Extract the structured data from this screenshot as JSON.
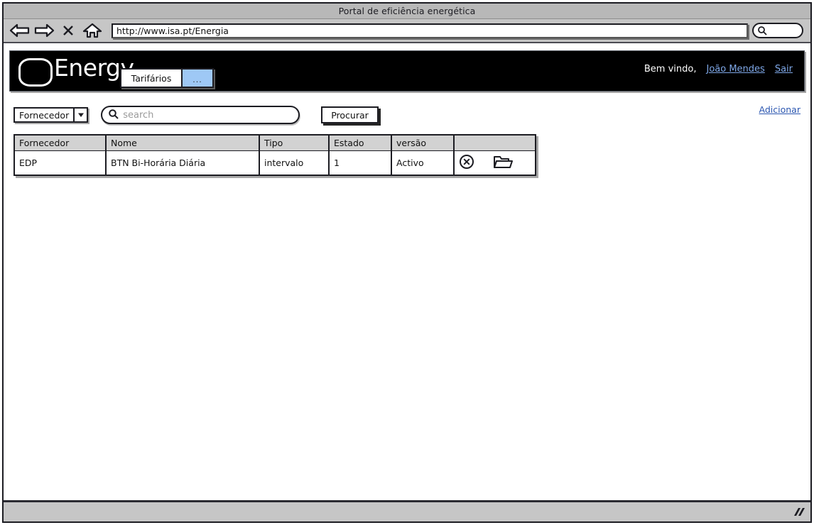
{
  "window": {
    "title": "Portal de eficiência energética"
  },
  "browser": {
    "back_icon": "arrow-left-icon",
    "forward_icon": "arrow-right-icon",
    "stop_icon": "stop-x-icon",
    "home_icon": "home-icon",
    "url": "http://www.isa.pt/Energia",
    "url_placeholder": "",
    "browser_search_icon": "search-icon",
    "browser_search_value": "",
    "browser_search_placeholder": ""
  },
  "app_header": {
    "logo_icon": "rounded-square-logo-icon",
    "logo_text": "Energy",
    "tabs": [
      {
        "label": "Tarifários",
        "active": true
      },
      {
        "label": "...",
        "active": false
      }
    ],
    "welcome_text": "Bem vindo,",
    "user_name": "João Mendes",
    "logout_label": "Sair"
  },
  "toolbar": {
    "filter_label": "Fornecedor",
    "filter_arrow_icon": "chevron-down-icon",
    "search_icon": "search-icon",
    "search_value": "",
    "search_placeholder": "search",
    "search_button_label": "Procurar",
    "add_link_label": "Adicionar"
  },
  "table": {
    "columns": [
      "Fornecedor",
      "Nome",
      "Tipo",
      "Estado",
      "versão",
      ""
    ],
    "rows": [
      {
        "fornecedor": "EDP",
        "nome": "BTN Bi-Horária Diária",
        "tipo": "intervalo",
        "estado": "1",
        "versao": "Activo",
        "actions": [
          "delete-circle-icon",
          "open-folder-icon"
        ]
      }
    ]
  },
  "status_bar": {
    "resize_grip_icon": "resize-grip-icon"
  },
  "colors": {
    "chrome_gray": "#c6c6c6",
    "title_gray": "#b8b8b8",
    "header_black": "#000000",
    "tab_blue": "#9ec8f5",
    "link_blue": "#2b56b0",
    "header_link_blue": "#7fa8e8",
    "table_header_gray": "#d2d2d2",
    "outline": "#1c1c22"
  }
}
